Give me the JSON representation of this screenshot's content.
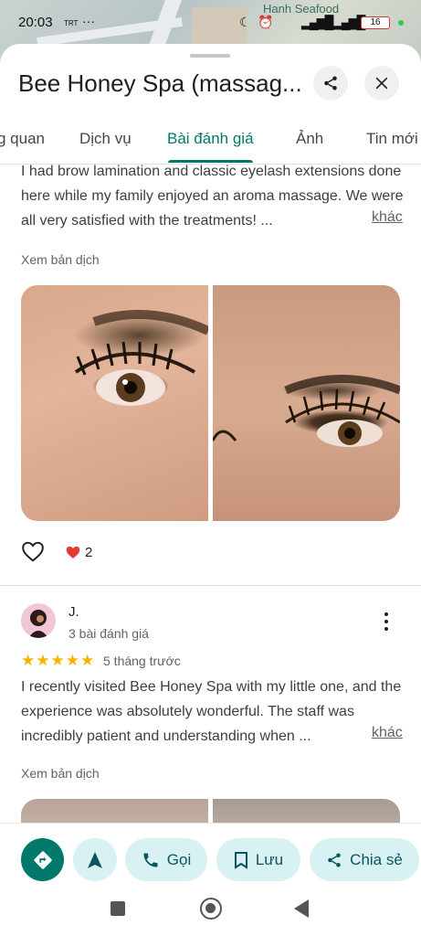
{
  "map": {
    "place_label": "Hanh Seafood"
  },
  "status_bar": {
    "time": "20:03",
    "carrier_tag": "TRT",
    "battery": "16",
    "more": "···"
  },
  "header": {
    "title": "Bee Honey Spa (massag...",
    "share_icon": "share-icon",
    "close_icon": "close-icon"
  },
  "tabs": [
    {
      "label": "g quan"
    },
    {
      "label": "Dịch vụ"
    },
    {
      "label": "Bài đánh giá",
      "active": true
    },
    {
      "label": "Ảnh"
    },
    {
      "label": "Tin mới"
    }
  ],
  "review1": {
    "text": "I had brow lamination and classic eyelash extensions done here while my family enjoyed an aroma massage. We were all very satisfied with the treatments! ...",
    "more": "khác",
    "translate": "Xem bản dịch",
    "likes": "2"
  },
  "review2": {
    "name": "J.",
    "review_count": "3 bài đánh giá",
    "stars": "★★★★★",
    "rating": 5,
    "time_ago": "5 tháng trước",
    "text": "I recently visited Bee Honey Spa with my little one, and the experience was absolutely wonderful. The staff was incredibly patient and understanding when ...",
    "more": "khác",
    "translate": "Xem bản dịch"
  },
  "actions": {
    "directions_icon": "directions-icon",
    "start_icon": "navigation-arrow-icon",
    "call": "Gọi",
    "save": "Lưu",
    "share": "Chia sẻ"
  },
  "colors": {
    "accent": "#00796b",
    "pill_bg": "#d8f2f3",
    "star": "#f4b400",
    "heart": "#e53935"
  }
}
